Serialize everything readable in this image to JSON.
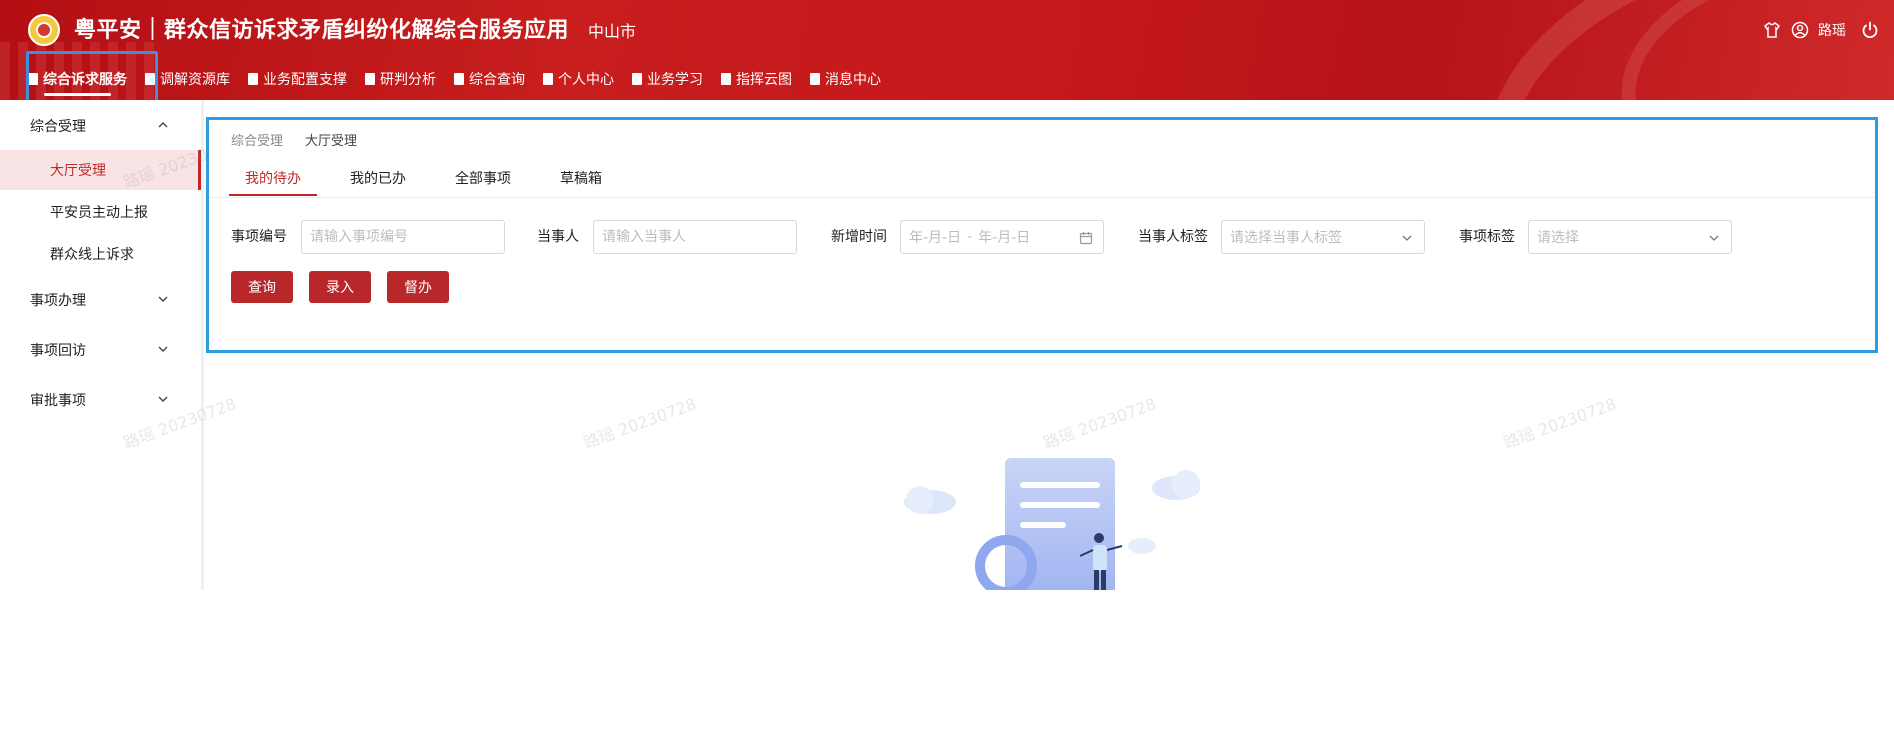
{
  "header": {
    "title": "粤平安｜群众信访诉求矛盾纠纷化解综合服务应用",
    "city": "中山市",
    "username": "路瑶"
  },
  "nav": {
    "items": [
      {
        "label": "综合诉求服务",
        "active": true
      },
      {
        "label": "调解资源库"
      },
      {
        "label": "业务配置支撑"
      },
      {
        "label": "研判分析"
      },
      {
        "label": "综合查询"
      },
      {
        "label": "个人中心"
      },
      {
        "label": "业务学习"
      },
      {
        "label": "指挥云图"
      },
      {
        "label": "消息中心"
      }
    ]
  },
  "sidebar": {
    "groups": [
      {
        "label": "综合受理",
        "expanded": true
      },
      {
        "label": "事项办理",
        "expanded": false
      },
      {
        "label": "事项回访",
        "expanded": false
      },
      {
        "label": "审批事项",
        "expanded": false
      }
    ],
    "items": [
      {
        "label": "大厅受理",
        "active": true
      },
      {
        "label": "平安员主动上报"
      },
      {
        "label": "群众线上诉求"
      }
    ]
  },
  "breadcrumb": [
    "综合受理",
    "大厅受理"
  ],
  "tabs": [
    {
      "label": "我的待办",
      "active": true
    },
    {
      "label": "我的已办"
    },
    {
      "label": "全部事项"
    },
    {
      "label": "草稿箱"
    }
  ],
  "filters": {
    "item_no": {
      "label": "事项编号",
      "placeholder": "请输入事项编号"
    },
    "party": {
      "label": "当事人",
      "placeholder": "请输入当事人"
    },
    "added_time": {
      "label": "新增时间",
      "start_placeholder": "年-月-日",
      "separator": "-",
      "end_placeholder": "年-月-日"
    },
    "party_tag": {
      "label": "当事人标签",
      "placeholder": "请选择当事人标签"
    },
    "item_tag": {
      "label": "事项标签",
      "placeholder": "请选择"
    }
  },
  "buttons": {
    "query": "查询",
    "enter": "录入",
    "supervise": "督办"
  },
  "watermark": "路瑶 20230728",
  "colors": {
    "header_red": "#c5181b",
    "accent_red": "#c0292a",
    "button_red": "#b8282b",
    "highlight_blue": "#2b9de0"
  }
}
